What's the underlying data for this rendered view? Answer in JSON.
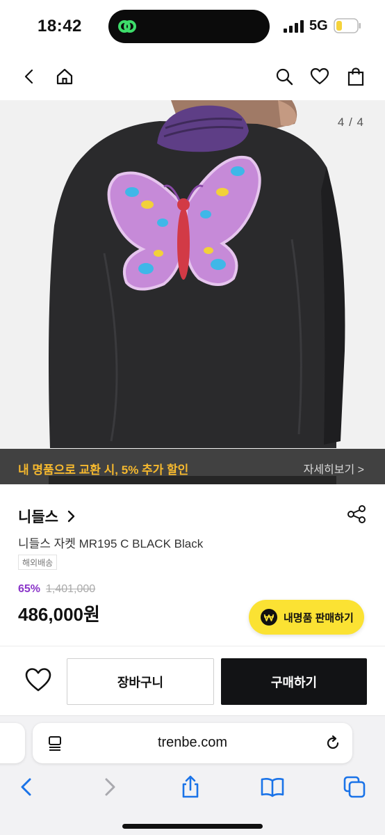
{
  "status_bar": {
    "time": "18:42",
    "network": "5G"
  },
  "header": {
    "icons": [
      "back-icon",
      "home-icon",
      "search-icon",
      "heart-icon",
      "shopping-bag-icon"
    ]
  },
  "gallery": {
    "counter": "4 / 4",
    "promo_text": "내 명품으로 교환 시, 5% 추가 할인",
    "promo_link": "자세히보기 >"
  },
  "product": {
    "brand": "니들스",
    "name": "니들스 자켓 MR195 C BLACK Black",
    "tag": "해외배송",
    "discount": "65%",
    "original_price": "1,401,000",
    "price": "486,000원"
  },
  "sell_button": {
    "label": "내명품 판매하기"
  },
  "action_bar": {
    "cart_label": "장바구니",
    "buy_label": "구매하기"
  },
  "browser": {
    "url": "trenbe.com"
  },
  "colors": {
    "accent_yellow": "#fbe233",
    "promo_text": "#f5b82e",
    "discount_purple": "#8a35c9",
    "buy_button": "#121315",
    "ios_blue": "#1a73e8"
  }
}
